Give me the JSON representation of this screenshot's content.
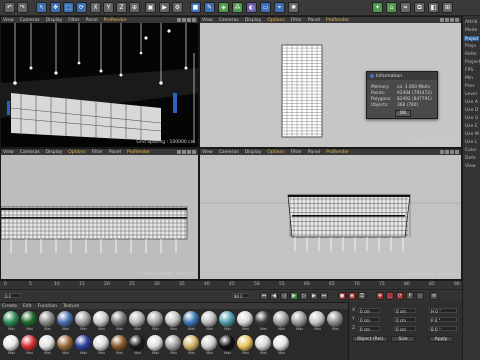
{
  "toolbar": {
    "icons": [
      {
        "name": "undo-icon",
        "glyph": "↶"
      },
      {
        "name": "redo-icon",
        "glyph": "↷"
      },
      {
        "name": "live-select-icon",
        "glyph": "↖"
      },
      {
        "name": "move-icon",
        "glyph": "✥"
      },
      {
        "name": "scale-icon",
        "glyph": "⬚"
      },
      {
        "name": "rotate-icon",
        "glyph": "⟳"
      },
      {
        "name": "x-axis-icon",
        "glyph": "X"
      },
      {
        "name": "y-axis-icon",
        "glyph": "Y"
      },
      {
        "name": "z-axis-icon",
        "glyph": "Z"
      },
      {
        "name": "world-axis-icon",
        "glyph": "⊕"
      },
      {
        "name": "render-view-icon",
        "glyph": "▣"
      },
      {
        "name": "render-picture-icon",
        "glyph": "▶"
      },
      {
        "name": "render-settings-icon",
        "glyph": "⚙"
      },
      {
        "name": "cube-icon",
        "glyph": "■"
      },
      {
        "name": "pen-icon",
        "glyph": "✎"
      },
      {
        "name": "subdivision-icon",
        "glyph": "◈"
      },
      {
        "name": "array-icon",
        "glyph": "⁂"
      },
      {
        "name": "deformer-icon",
        "glyph": "◐"
      },
      {
        "name": "floor-icon",
        "glyph": "▭"
      },
      {
        "name": "camera-icon",
        "glyph": "⌖"
      },
      {
        "name": "light-icon",
        "glyph": "✺"
      }
    ]
  },
  "viewports": {
    "perspective": {
      "menu": [
        "View",
        "Cameras",
        "Display",
        "Filter",
        "Panel",
        "ProRender"
      ],
      "label": "",
      "footer": "Grid Spacing : 100000 cm"
    },
    "top": {
      "menu": [
        "View",
        "Cameras",
        "Display",
        "Options",
        "Filter",
        "Panel",
        "ProRender"
      ],
      "label": "Top",
      "footer": "Grid Spacing : 1000 cm"
    },
    "right": {
      "menu": [
        "View",
        "Cameras",
        "Display",
        "Options",
        "Filter",
        "Panel",
        "ProRender"
      ],
      "label": "",
      "footer": "Grid Spacing : 1000 cm"
    },
    "front": {
      "menu": [
        "View",
        "Cameras",
        "Display",
        "Options",
        "Filter",
        "Panel",
        "ProRender"
      ],
      "label": "Front",
      "footer": "Grid Spacing : 1000 cm"
    }
  },
  "info_dialog": {
    "title": "Information",
    "rows": [
      {
        "label": "Memory:",
        "value": "ca. 3 000 Mbits"
      },
      {
        "label": "Points:",
        "value": "92494 (791472)"
      },
      {
        "label": "Polygons:",
        "value": "82492 (847791)"
      },
      {
        "label": "Objects:",
        "value": "368 (780)"
      }
    ],
    "ok_label": "OK"
  },
  "timeline": {
    "ticks": [
      "0",
      "5",
      "10",
      "15",
      "20",
      "25",
      "30",
      "35",
      "40",
      "45",
      "50",
      "55",
      "60",
      "65",
      "70",
      "75",
      "80",
      "85",
      "90"
    ],
    "frame_field": "0 F",
    "end_field": "90 F"
  },
  "materials": {
    "menu": [
      "Create",
      "Edit",
      "Function",
      "Texture"
    ],
    "row1": [
      {
        "label": "Mat",
        "color": "#2e8b57"
      },
      {
        "label": "Mat",
        "color": "#1e6a2a"
      },
      {
        "label": "Mat",
        "color": "#8a8a8a"
      },
      {
        "label": "Mat",
        "color": "#4a6fb0"
      },
      {
        "label": "Mat",
        "color": "#9e9e9e"
      },
      {
        "label": "Mat",
        "color": "#c9c9c9"
      },
      {
        "label": "Mat",
        "color": "#7c7c7c"
      },
      {
        "label": "Mat",
        "color": "#b7b7b7"
      },
      {
        "label": "Mat",
        "color": "#a5a5a5"
      },
      {
        "label": "Mat",
        "color": "#c2c2c2"
      },
      {
        "label": "Mat",
        "color": "#3c78b5"
      },
      {
        "label": "Mat",
        "color": "#bdbdbd"
      },
      {
        "label": "Mat",
        "color": "#4f9eae"
      },
      {
        "label": "Mat",
        "color": "#d8d8d8"
      },
      {
        "label": "Mat",
        "color": "#3b3b3b"
      },
      {
        "label": "Mat",
        "color": "#a0a0a0"
      },
      {
        "label": "Mat",
        "color": "#9c9c9c"
      },
      {
        "label": "Mat",
        "color": "#c6c6c6"
      },
      {
        "label": "Mat",
        "color": "#8f8f8f"
      }
    ],
    "row2": [
      {
        "label": "Mat",
        "color": "#e9e9e9"
      },
      {
        "label": "Mat",
        "color": "#d43030"
      },
      {
        "label": "Mat",
        "color": "#e2e2e2"
      },
      {
        "label": "Mat",
        "color": "#9a6a3a"
      },
      {
        "label": "Mat",
        "color": "#2b3f9e"
      },
      {
        "label": "Mat",
        "color": "#dcdcdc"
      },
      {
        "label": "Mat",
        "color": "#8a5a2a"
      },
      {
        "label": "Mat",
        "color": "#1a1a1a"
      },
      {
        "label": "Mat",
        "color": "#e0e0e0"
      },
      {
        "label": "Mat",
        "color": "#a3a3a3"
      },
      {
        "label": "Mat",
        "color": "#d2b36a"
      },
      {
        "label": "Mat",
        "color": "#cfcfcf"
      },
      {
        "label": "Mat",
        "color": "#111111"
      },
      {
        "label": "Mat",
        "color": "#e6c25a"
      },
      {
        "label": "Mat",
        "color": "#d8d8d8"
      },
      {
        "label": "Mat",
        "color": "#e5e5e5"
      }
    ]
  },
  "coords": {
    "rows": [
      {
        "axis": "X",
        "pos": "0 cm",
        "size": "0 cm",
        "rot": "H 0 °"
      },
      {
        "axis": "Y",
        "pos": "0 cm",
        "size": "0 cm",
        "rot": "P 0 °"
      },
      {
        "axis": "Z",
        "pos": "0 cm",
        "size": "0 cm",
        "rot": "B 0 °"
      }
    ],
    "mode_left": "Object (Rel)",
    "mode_right": "Size",
    "apply_label": "Apply"
  },
  "right_panel": {
    "tabs": [
      "Mode",
      "Edit",
      "User Data"
    ],
    "rows": [
      "Attrib",
      "Mode",
      "Project",
      "Proje",
      "Refer",
      "Project",
      "FPS",
      "Min",
      "Prev",
      "Level",
      "Use A",
      "Use D",
      "Use G",
      "Use E",
      "Use M",
      "Use L",
      "Color",
      "Defa",
      "View"
    ],
    "highlight": "Project"
  }
}
